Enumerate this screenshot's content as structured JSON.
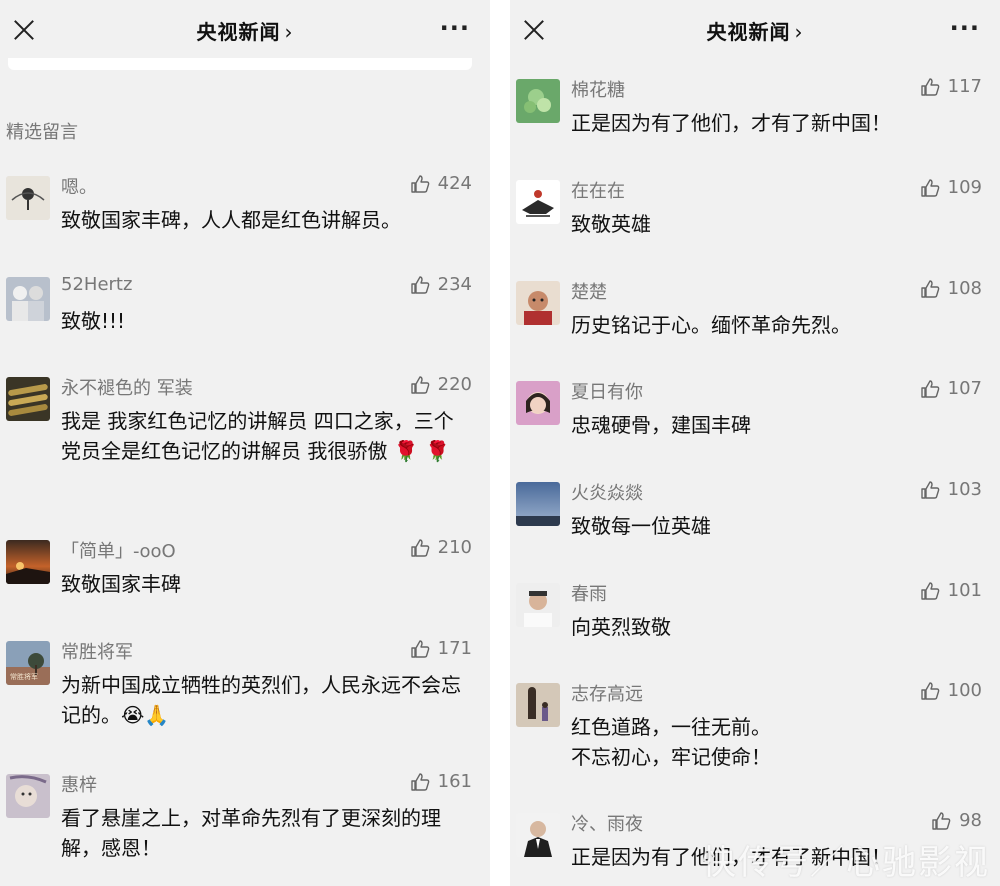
{
  "left": {
    "header": {
      "title": "央视新闻",
      "chevron": "›",
      "more": "···"
    },
    "section_label": "精选留言",
    "comments": [
      {
        "name": "嗯。",
        "likes": "424",
        "text": "致敬国家丰碑，人人都是红色讲解员。"
      },
      {
        "name": "52Hertz",
        "likes": "234",
        "text": "致敬!!!"
      },
      {
        "name": "永不褪色的 军装",
        "likes": "220",
        "text": "我是 我家红色记忆的讲解员 四口之家，三个党员全是红色记忆的讲解员 我很骄傲 🌹 🌹"
      },
      {
        "name": "「简单」-ooO",
        "likes": "210",
        "text": "致敬国家丰碑"
      },
      {
        "name": "常胜将军",
        "likes": "171",
        "text": "为新中国成立牺牲的英烈们，人民永远不会忘记的。😭🙏"
      },
      {
        "name": "惠梓",
        "likes": "161",
        "text": "看了悬崖之上，对革命先烈有了更深刻的理解，感恩！"
      }
    ]
  },
  "right": {
    "header": {
      "title": "央视新闻",
      "chevron": "›",
      "more": "···"
    },
    "comments": [
      {
        "name": "棉花糖",
        "likes": "117",
        "text": "正是因为有了他们，才有了新中国！"
      },
      {
        "name": "在在在",
        "likes": "109",
        "text": "致敬英雄"
      },
      {
        "name": "楚楚",
        "likes": "108",
        "text": "历史铭记于心。缅怀革命先烈。"
      },
      {
        "name": "夏日有你",
        "likes": "107",
        "text": "忠魂硬骨，建国丰碑"
      },
      {
        "name": "火炎焱燚",
        "likes": "103",
        "text": "致敬每一位英雄"
      },
      {
        "name": "春雨",
        "likes": "101",
        "text": "向英烈致敬"
      },
      {
        "name": "志存高远",
        "likes": "100",
        "text": "红色道路，一往无前。\n不忘初心，牢记使命！"
      },
      {
        "name": "冷、雨夜",
        "likes": "98",
        "text": "正是因为有了他们，才有了新中国！"
      }
    ]
  },
  "watermark": "快传号／心驰影视",
  "colors": {
    "background": "#f1f1f1",
    "text": "#111111",
    "meta": "#777777"
  }
}
